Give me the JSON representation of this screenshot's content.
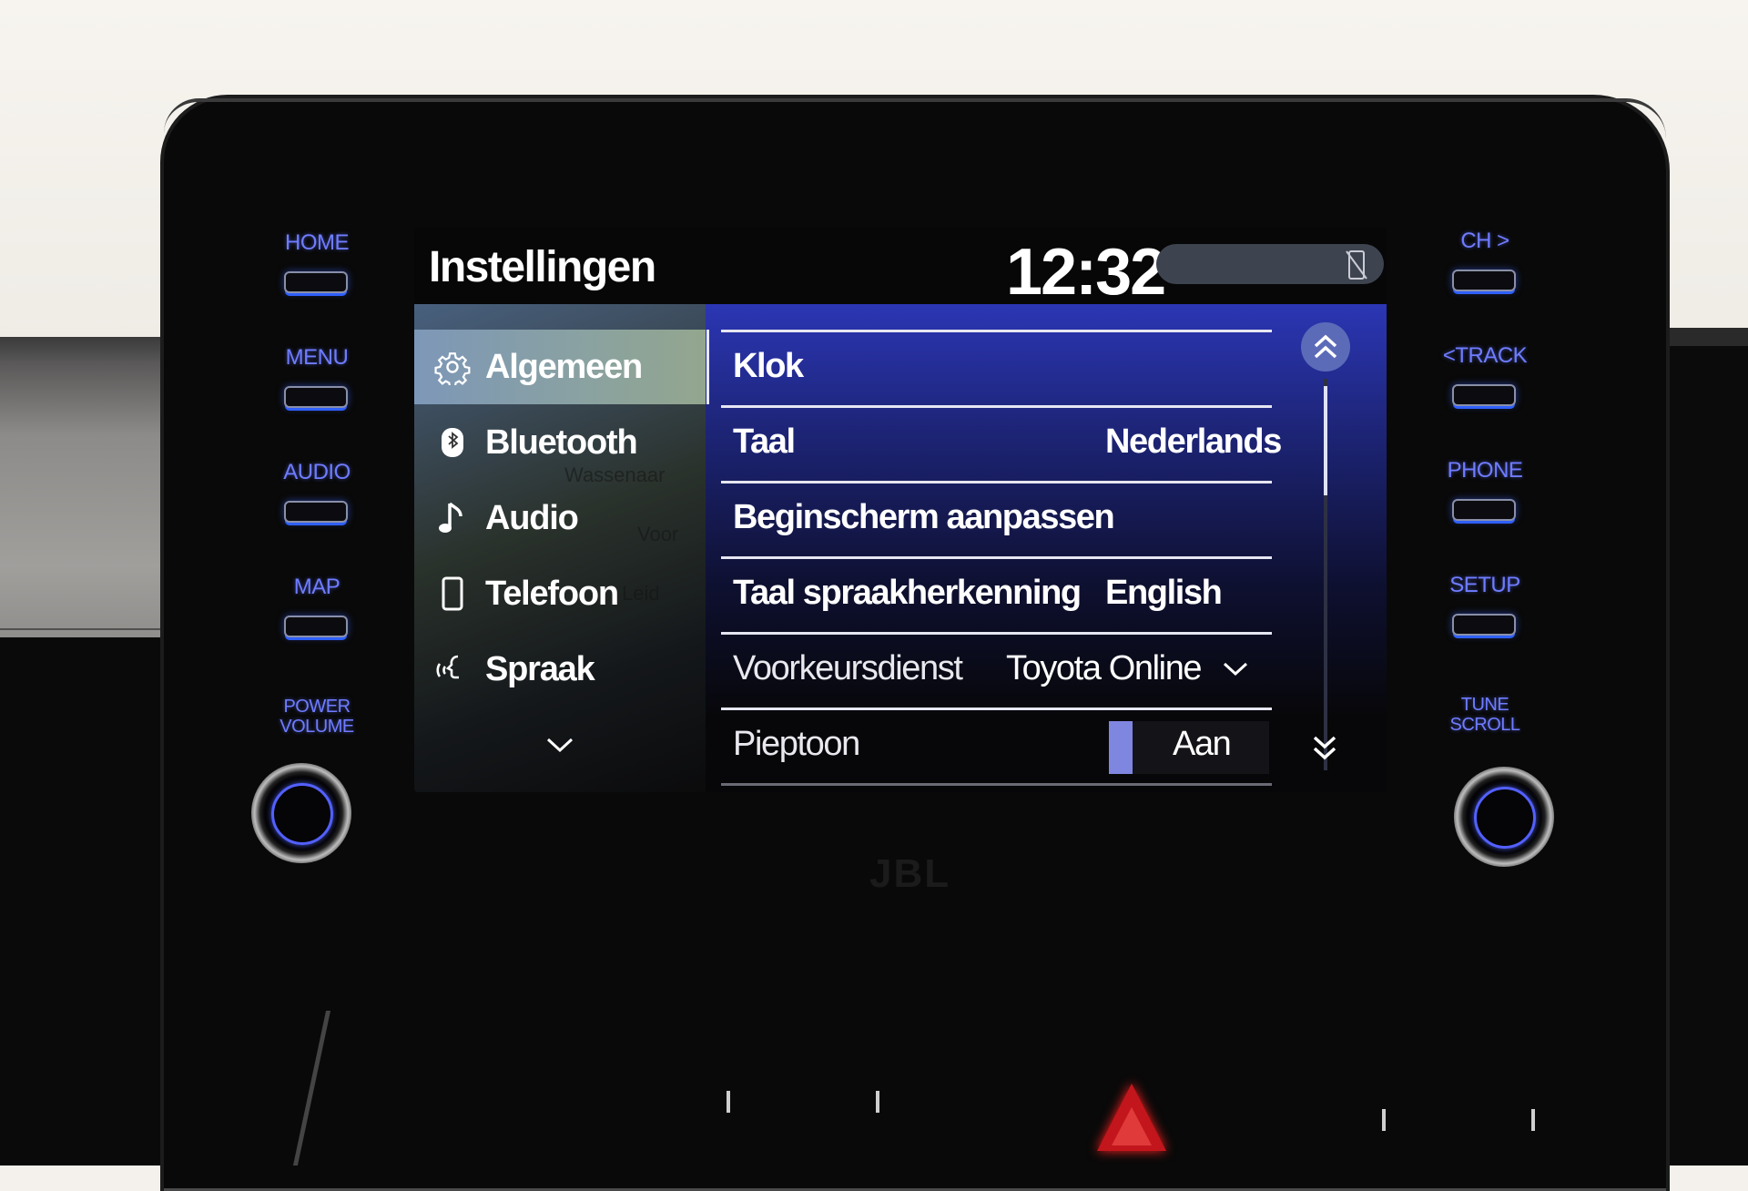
{
  "screen": {
    "title": "Instellingen",
    "clock": "12:32",
    "status_icon": "phone-disconnected-icon"
  },
  "sidebar": {
    "items": [
      {
        "label": "Algemeen",
        "icon": "gear-icon",
        "active": true
      },
      {
        "label": "Bluetooth",
        "icon": "bluetooth-icon",
        "active": false
      },
      {
        "label": "Audio",
        "icon": "music-note-icon",
        "active": false
      },
      {
        "label": "Telefoon",
        "icon": "phone-icon",
        "active": false
      },
      {
        "label": "Spraak",
        "icon": "voice-icon",
        "active": false
      }
    ],
    "more_icon": "chevron-down-icon",
    "map_labels": [
      "Wassenaar",
      "Voor",
      "Leid"
    ]
  },
  "settings": {
    "rows": [
      {
        "label": "Klok",
        "value": ""
      },
      {
        "label": "Taal",
        "value": "Nederlands"
      },
      {
        "label": "Beginscherm aanpassen",
        "value": ""
      },
      {
        "label": "Taal spraakherkenning",
        "value": "English"
      },
      {
        "label": "Voorkeursdienst",
        "value": "Toyota Online"
      },
      {
        "label": "Pieptoon",
        "value": "Aan"
      }
    ],
    "scroll_up_icon": "double-chevron-up-icon",
    "scroll_down_icon": "double-chevron-down-icon"
  },
  "hard_keys": {
    "left": [
      "HOME",
      "MENU",
      "AUDIO",
      "MAP"
    ],
    "left_knob": [
      "POWER",
      "VOLUME"
    ],
    "right": [
      "CH >",
      "<TRACK",
      "PHONE",
      "SETUP"
    ],
    "right_knob": [
      "TUNE",
      "SCROLL"
    ]
  },
  "brand": {
    "speaker_logo": "JBL"
  },
  "colors": {
    "key_backlight": "#6f7cff",
    "selection": "#7d97b8",
    "list_gradient_top": "#2b36b4",
    "hazard": "#c2161c"
  }
}
